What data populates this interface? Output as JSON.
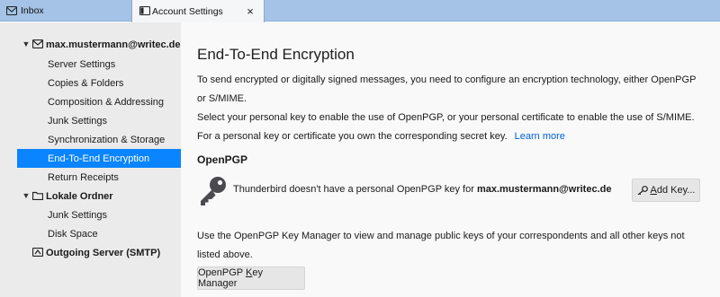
{
  "tabs": [
    {
      "label": "Inbox"
    },
    {
      "label": "Account Settings",
      "close": "×"
    }
  ],
  "sidebar": {
    "account": "max.mustermann@writec.de",
    "account_items": [
      "Server Settings",
      "Copies & Folders",
      "Composition & Addressing",
      "Junk Settings",
      "Synchronization & Storage",
      "End-To-End Encryption",
      "Return Receipts"
    ],
    "selected_index": 5,
    "local_folders": "Lokale Ordner",
    "local_items": [
      "Junk Settings",
      "Disk Space"
    ],
    "outgoing": "Outgoing Server (SMTP)"
  },
  "main": {
    "title": "End-To-End Encryption",
    "intro": "To send encrypted or digitally signed messages, you need to configure an encryption technology, either OpenPGP or S/MIME.",
    "select_text": "Select your personal key to enable the use of OpenPGP, or your personal certificate to enable the use of S/MIME. For a personal key or certificate you own the corresponding secret key.",
    "learn_more": "Learn more",
    "openpgp_title": "OpenPGP",
    "no_key_text": "Thunderbird doesn't have a personal OpenPGP key for",
    "no_key_account": "max.mustermann@writec.de",
    "add_key_button": {
      "pre": "",
      "access": "A",
      "post": "dd Key..."
    },
    "manager_text": "Use the OpenPGP Key Manager to view and manage public keys of your correspondents and all other keys not listed above.",
    "manager_button": {
      "pre": "OpenPGP ",
      "access": "K",
      "post": "ey Manager"
    }
  },
  "colors": {
    "accent": "#0a84ff",
    "link": "#0060df",
    "tabbar": "#a4c3e6",
    "sidebar_bg": "#ebebeb",
    "main_bg": "#f9f9fa"
  },
  "icons": {
    "inbox_tab": "mail-icon",
    "settings_tab": "settings-page-icon",
    "account": "mail-account-icon",
    "local": "folder-icon",
    "outgoing": "outgoing-server-icon",
    "key": "key-icon"
  }
}
